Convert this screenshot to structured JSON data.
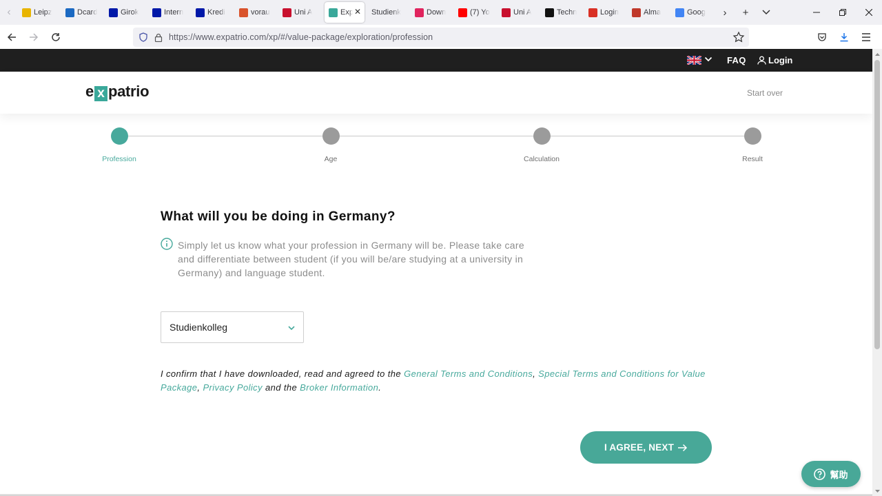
{
  "browser": {
    "tabs": [
      {
        "label": "Leipz",
        "icon": "leipzig-favicon",
        "color": "#e8b400"
      },
      {
        "label": "Dcard",
        "icon": "dcard-favicon",
        "color": "#1b69c2"
      },
      {
        "label": "Girok",
        "icon": "deutsche-bank-favicon",
        "color": "#0018a8"
      },
      {
        "label": "Intern",
        "icon": "deutsche-bank-favicon",
        "color": "#0018a8"
      },
      {
        "label": "Kredi",
        "icon": "deutsche-bank-favicon",
        "color": "#0018a8"
      },
      {
        "label": "vorau",
        "icon": "calendar-favicon",
        "color": "#d9532c"
      },
      {
        "label": "Uni A",
        "icon": "japan-flag-favicon",
        "color": "#c8102e"
      },
      {
        "label": "Exp",
        "icon": "expatrio-favicon",
        "color": "#3aa89a",
        "active": true
      },
      {
        "label": "Studienk",
        "icon": "",
        "color": ""
      },
      {
        "label": "Down",
        "icon": "heart-favicon",
        "color": "#e0245e"
      },
      {
        "label": "(7) Yo",
        "icon": "youtube-favicon",
        "color": "#ff0000"
      },
      {
        "label": "Uni A",
        "icon": "japan-flag-favicon",
        "color": "#c8102e"
      },
      {
        "label": "Techn",
        "icon": "asc-favicon",
        "color": "#111111"
      },
      {
        "label": "Login",
        "icon": "gmail-favicon",
        "color": "#d93025"
      },
      {
        "label": "Alma",
        "icon": "alma-favicon",
        "color": "#c0392b"
      },
      {
        "label": "Goog",
        "icon": "google-favicon",
        "color": "#4285f4"
      }
    ],
    "url": "https://www.expatrio.com/xp/#/value-package/exploration/profession"
  },
  "topbar": {
    "faq": "FAQ",
    "login": "Login"
  },
  "header": {
    "logo_pre": "e",
    "logo_x": "x",
    "logo_post": "patrio",
    "start_over": "Start over"
  },
  "stepper": {
    "steps": [
      {
        "label": "Profession",
        "active": true
      },
      {
        "label": "Age",
        "active": false
      },
      {
        "label": "Calculation",
        "active": false
      },
      {
        "label": "Result",
        "active": false
      }
    ]
  },
  "main": {
    "question": "What will you be doing in Germany?",
    "info": "Simply let us know what your profession in Germany will be. Please take care and differentiate between student (if you will be/are studying at a university in Germany) and language student.",
    "profession_value": "Studienkolleg",
    "terms": {
      "prefix": "I confirm that I have downloaded, read and agreed to the ",
      "link_general": "General Terms and Conditions",
      "sep1": ", ",
      "link_special": "Special Terms and Conditions for Value Package",
      "sep2": ", ",
      "link_privacy": "Privacy Policy",
      "sep3": " and the ",
      "link_broker": "Broker Information",
      "suffix": "."
    },
    "next_button": "I AGREE, NEXT",
    "help_button": "幫助"
  },
  "colors": {
    "accent": "#47a99c",
    "topbar": "#1f1f1f"
  }
}
